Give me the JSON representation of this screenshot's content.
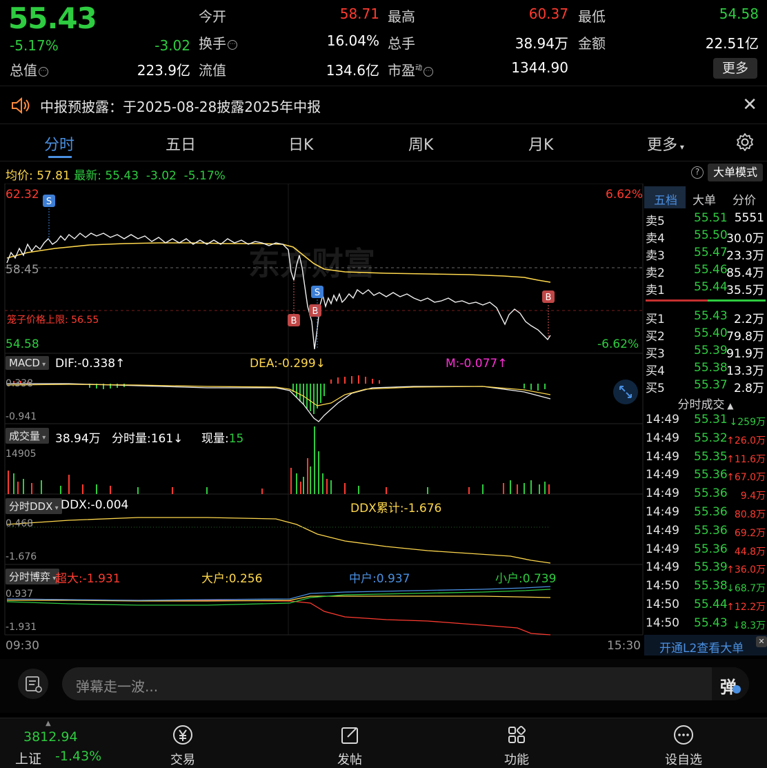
{
  "quote": {
    "price": "55.43",
    "change_pct": "-5.17%",
    "change": "-3.02",
    "open_label": "今开",
    "open": "58.71",
    "high_label": "最高",
    "high": "60.37",
    "low_label": "最低",
    "low": "54.58",
    "turnover_label": "换手",
    "turnover": "16.04%",
    "volume_label": "总手",
    "volume": "38.94万",
    "amount_label": "金额",
    "amount": "22.51亿",
    "mktcap_label": "总值",
    "mktcap": "223.9亿",
    "float_label": "流值",
    "float": "134.6亿",
    "pe_label": "市盈",
    "pe_sup": "动",
    "pe": "1344.90",
    "more_button": "更多"
  },
  "notice": {
    "text": "中报预披露：于2025-08-28披露2025年中报"
  },
  "tabs": [
    "分时",
    "五日",
    "日K",
    "周K",
    "月K",
    "更多"
  ],
  "chart_header": {
    "avg_label": "均价:",
    "avg": "57.81",
    "latest_label": "最新:",
    "latest": "55.43",
    "chg": "-3.02",
    "pct": "-5.17%",
    "help_icon": "?",
    "big_order_mode": "大单模式"
  },
  "price_chart": {
    "y_top": "62.32",
    "y_mid": "58.45",
    "y_bottom": "54.58",
    "pct_top": "6.62%",
    "pct_bottom": "-6.62%",
    "limit_label": "笼子价格上限: 56.55",
    "watermark": "东方财富",
    "markers": [
      "S",
      "B",
      "B",
      "S",
      "B"
    ]
  },
  "macd": {
    "selector": "MACD",
    "dif": "DIF:-0.338↑",
    "dea": "DEA:-0.299↓",
    "m": "M:-0.077↑",
    "y_top": "0.338",
    "y_bottom": "-0.941"
  },
  "volume": {
    "selector": "成交量",
    "total": "38.94万",
    "minute_label": "分时量:161↓",
    "now_label": "现量:",
    "now": "15",
    "y_top": "14905"
  },
  "ddx": {
    "selector": "分时DDX",
    "ddx": "DDX:-0.004",
    "cum": "DDX累计:-1.676",
    "y_top": "0.468",
    "y_bottom": "-1.676"
  },
  "game": {
    "selector": "分时博弈",
    "super_label": "超大:-1.931",
    "big_label": "大户:0.256",
    "mid_label": "中户:0.937",
    "small_label": "小户:0.739",
    "y_top": "0.937",
    "y_bottom": "-1.931"
  },
  "time_axis": {
    "start": "09:30",
    "end": "15:30"
  },
  "panel": {
    "tabs": [
      "五档",
      "大单",
      "分价"
    ],
    "asks": [
      {
        "k": "卖5",
        "p": "55.51",
        "v": "5551"
      },
      {
        "k": "卖4",
        "p": "55.50",
        "v": "30.0万"
      },
      {
        "k": "卖3",
        "p": "55.47",
        "v": "23.3万"
      },
      {
        "k": "卖2",
        "p": "55.46",
        "v": "85.4万"
      },
      {
        "k": "卖1",
        "p": "55.44",
        "v": "35.5万"
      }
    ],
    "bids": [
      {
        "k": "买1",
        "p": "55.43",
        "v": "2.2万"
      },
      {
        "k": "买2",
        "p": "55.40",
        "v": "79.8万"
      },
      {
        "k": "买3",
        "p": "55.39",
        "v": "91.9万"
      },
      {
        "k": "买4",
        "p": "55.38",
        "v": "13.3万"
      },
      {
        "k": "买5",
        "p": "55.37",
        "v": "2.8万"
      }
    ],
    "trades_title": "分时成交",
    "trades": [
      {
        "t": "14:49",
        "p": "55.31",
        "v": "↓259万",
        "dir": "down"
      },
      {
        "t": "14:49",
        "p": "55.32",
        "v": "↑26.0万",
        "dir": "up"
      },
      {
        "t": "14:49",
        "p": "55.35",
        "v": "↑11.6万",
        "dir": "up"
      },
      {
        "t": "14:49",
        "p": "55.36",
        "v": "↑67.0万",
        "dir": "up"
      },
      {
        "t": "14:49",
        "p": "55.36",
        "v": "9.4万",
        "dir": "flat"
      },
      {
        "t": "14:49",
        "p": "55.36",
        "v": "80.8万",
        "dir": "flat"
      },
      {
        "t": "14:49",
        "p": "55.36",
        "v": "69.2万",
        "dir": "flat"
      },
      {
        "t": "14:49",
        "p": "55.36",
        "v": "44.8万",
        "dir": "flat"
      },
      {
        "t": "14:49",
        "p": "55.39",
        "v": "↑36.0万",
        "dir": "up"
      },
      {
        "t": "14:50",
        "p": "55.38",
        "v": "↓68.7万",
        "dir": "down"
      },
      {
        "t": "14:50",
        "p": "55.44",
        "v": "↑12.2万",
        "dir": "up"
      },
      {
        "t": "14:50",
        "p": "55.43",
        "v": "↓8.3万",
        "dir": "down"
      }
    ],
    "l2_button": "开通L2查看大单"
  },
  "comment": {
    "placeholder": "弹幕走一波...",
    "danmu_button": "弹"
  },
  "index": {
    "value": "3812.94",
    "name": "上证",
    "pct": "-1.43%"
  },
  "nav": [
    "交易",
    "发帖",
    "功能",
    "设自选"
  ],
  "colors": {
    "up": "#ff3b30",
    "down": "#2ecc40",
    "accent": "#4a90e2",
    "avg_line": "#ffd84d"
  }
}
